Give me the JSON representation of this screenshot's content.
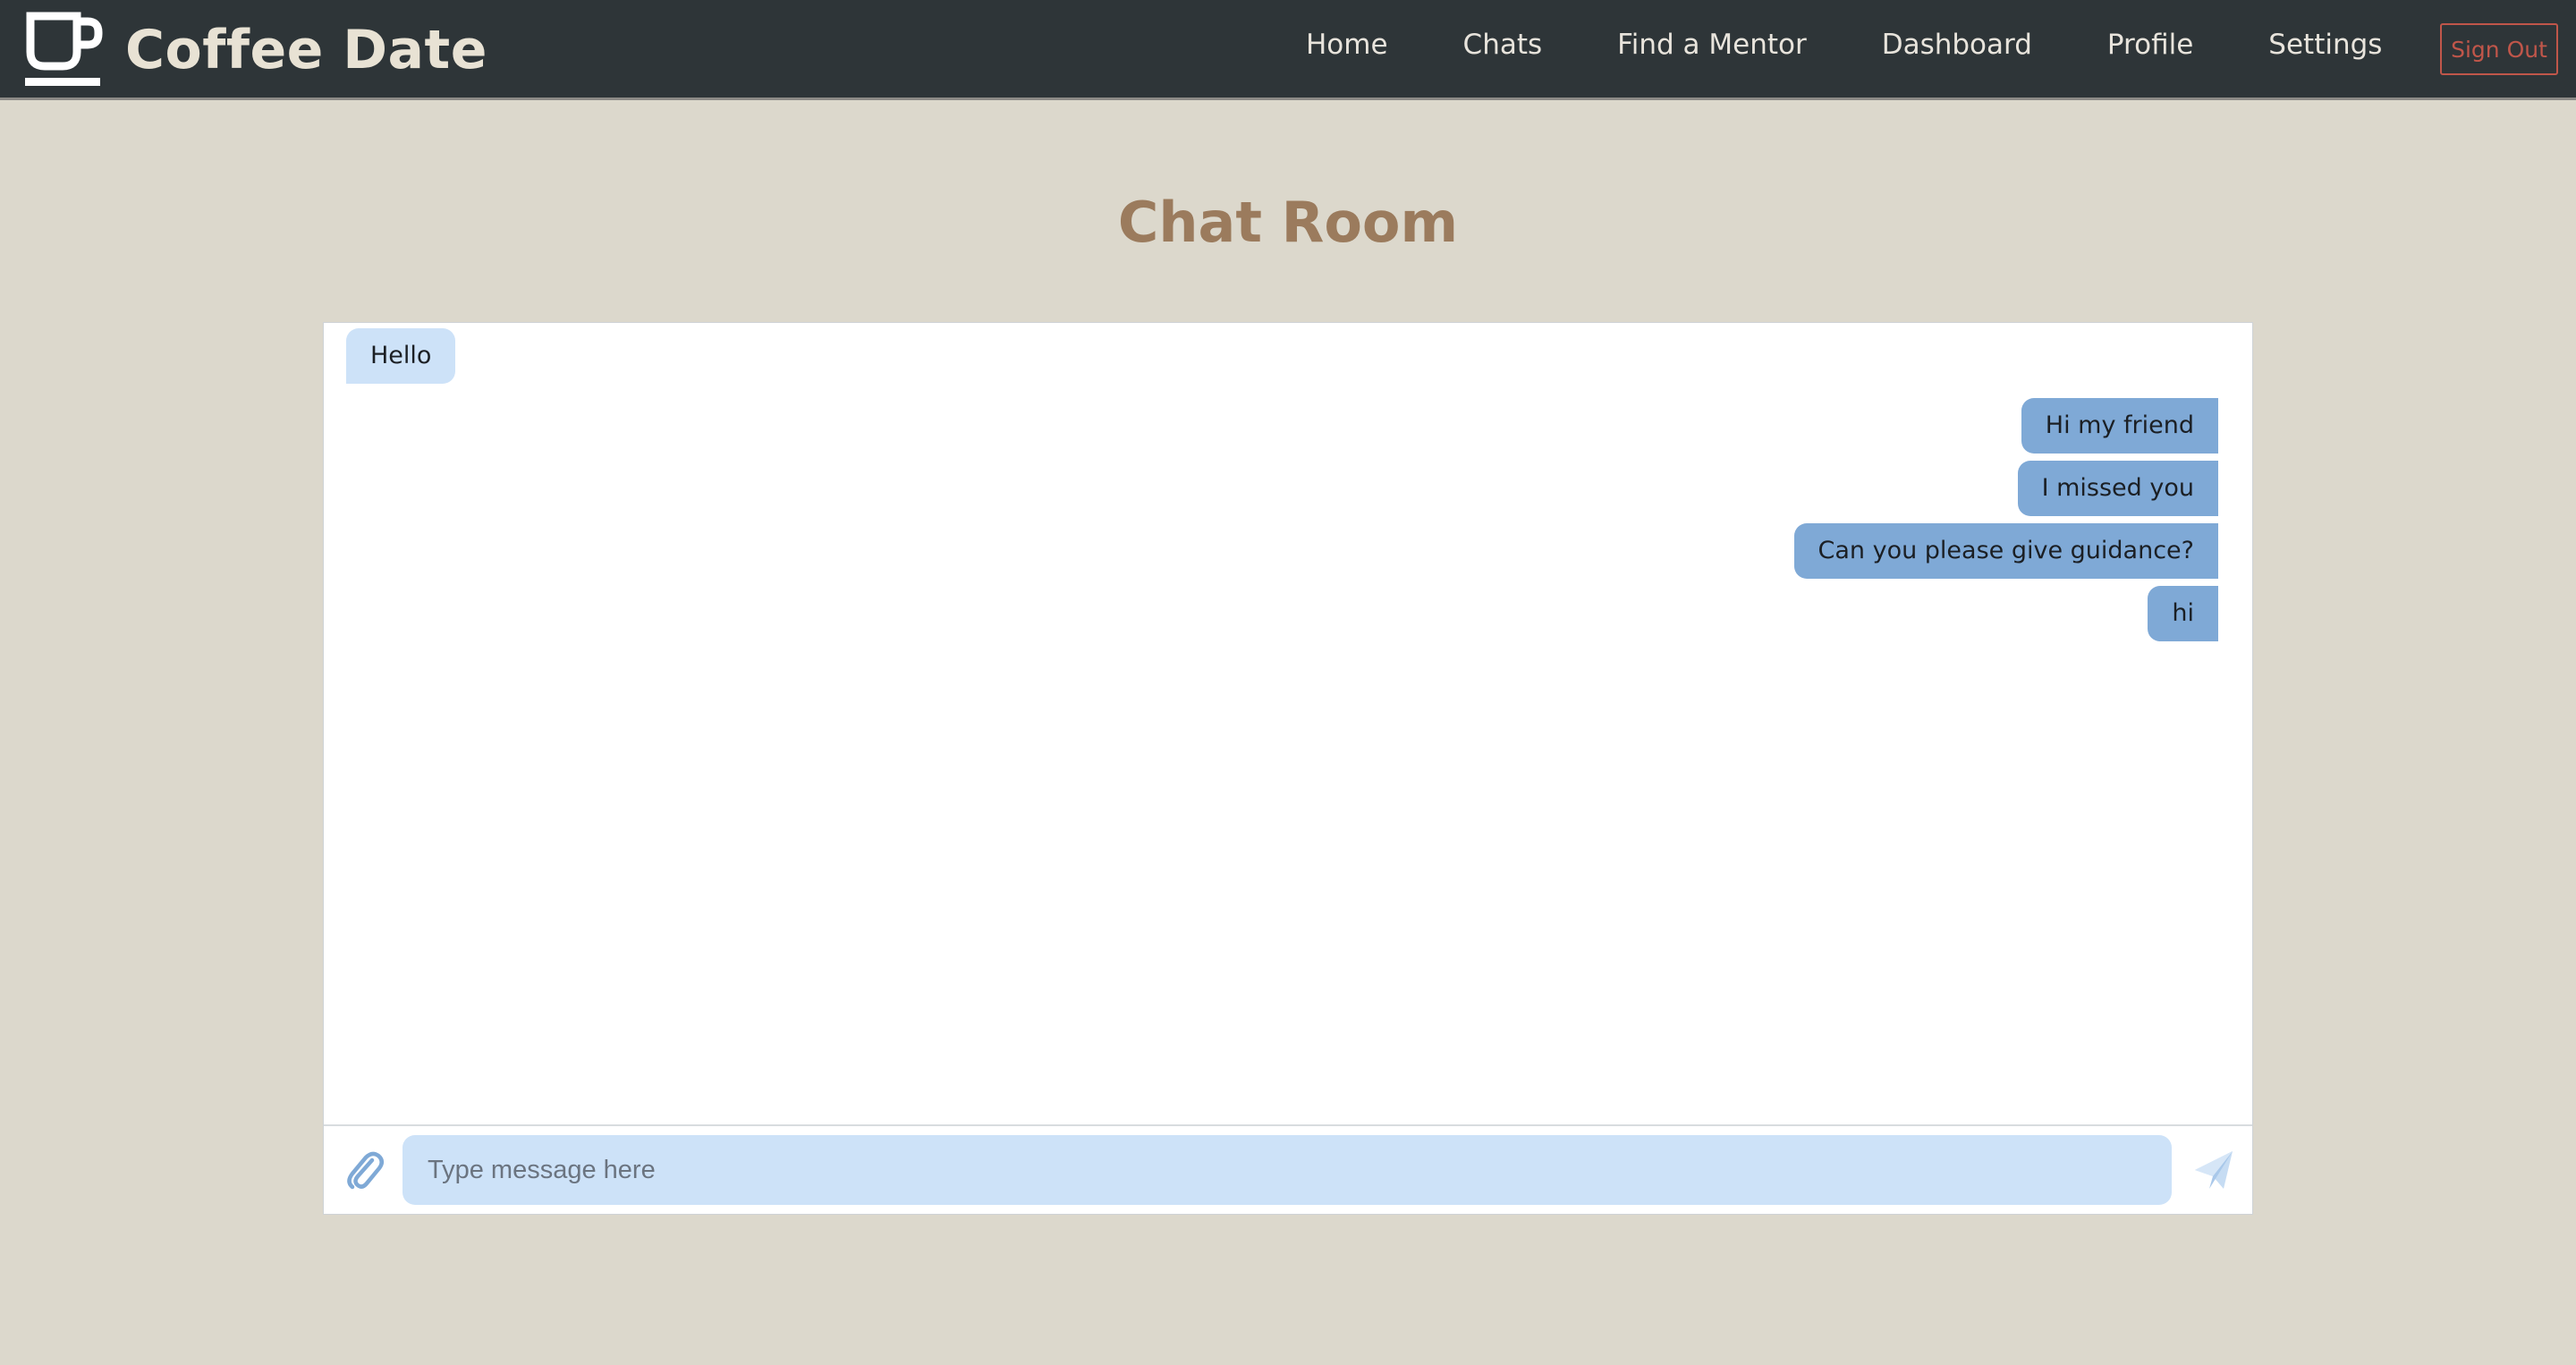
{
  "app": {
    "brand_name": "Coffee Date",
    "brand_icon": "coffee-cup-icon"
  },
  "nav": {
    "items": [
      "Home",
      "Chats",
      "Find a Mentor",
      "Dashboard",
      "Profile",
      "Settings"
    ],
    "sign_out_label": "Sign Out"
  },
  "page": {
    "title": "Chat Room"
  },
  "messages": [
    {
      "text": "Hello",
      "direction": "received"
    },
    {
      "text": "Hi my friend",
      "direction": "sent"
    },
    {
      "text": "I missed you",
      "direction": "sent"
    },
    {
      "text": "Can you please give guidance?",
      "direction": "sent"
    },
    {
      "text": "hi",
      "direction": "sent"
    }
  ],
  "composer": {
    "placeholder": "Type message here",
    "value": "",
    "attach_icon": "paperclip-icon",
    "send_icon": "send-icon"
  },
  "colors": {
    "navbar_bg": "#2e3538",
    "page_bg": "#dcd8cc",
    "title": "#9b7b5d",
    "received_bubble": "#cde2f8",
    "sent_bubble": "#7fa9d6",
    "sign_out": "#c0564a"
  }
}
